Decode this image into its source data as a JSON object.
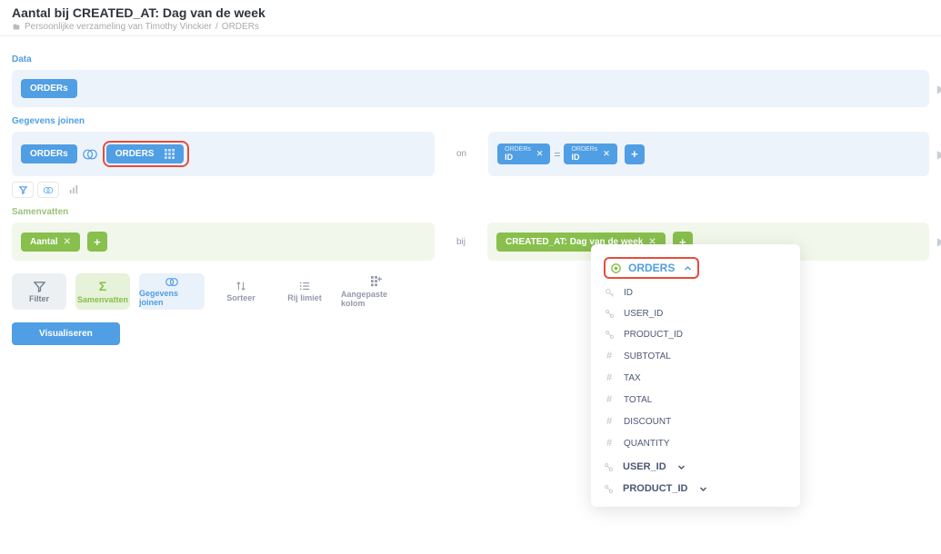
{
  "header": {
    "title": "Aantal bij CREATED_AT: Dag van de week",
    "breadcrumb_collection": "Persoonlijke verzameling van Timothy Vinckier",
    "breadcrumb_item": "ORDERs"
  },
  "sections": {
    "data_label": "Data",
    "join_label": "Gegevens joinen",
    "summarize_label": "Samenvatten",
    "on_label": "on",
    "by_label": "bij"
  },
  "data": {
    "source_pill": "ORDERs"
  },
  "join": {
    "left_pill": "ORDERs",
    "right_pill": "ORDERS",
    "left_cond_table": "ORDERs",
    "left_cond_field": "ID",
    "right_cond_table": "ORDERs",
    "right_cond_field": "ID"
  },
  "summarize": {
    "aggregate_label": "Aantal",
    "breakout_label": "CREATED_AT: Dag van de week"
  },
  "actions": {
    "filter": "Filter",
    "summarize": "Samenvatten",
    "join": "Gegevens joinen",
    "sort": "Sorteer",
    "limit": "Rij limiet",
    "custom": "Aangepaste kolom",
    "visualize": "Visualiseren"
  },
  "dropdown": {
    "table_name": "ORDERS",
    "fields": [
      {
        "name": "ID",
        "type": "key"
      },
      {
        "name": "USER_ID",
        "type": "fk"
      },
      {
        "name": "PRODUCT_ID",
        "type": "fk"
      },
      {
        "name": "SUBTOTAL",
        "type": "num"
      },
      {
        "name": "TAX",
        "type": "num"
      },
      {
        "name": "TOTAL",
        "type": "num"
      },
      {
        "name": "DISCOUNT",
        "type": "num"
      },
      {
        "name": "QUANTITY",
        "type": "num"
      }
    ],
    "groups": [
      "USER_ID",
      "PRODUCT_ID"
    ]
  }
}
